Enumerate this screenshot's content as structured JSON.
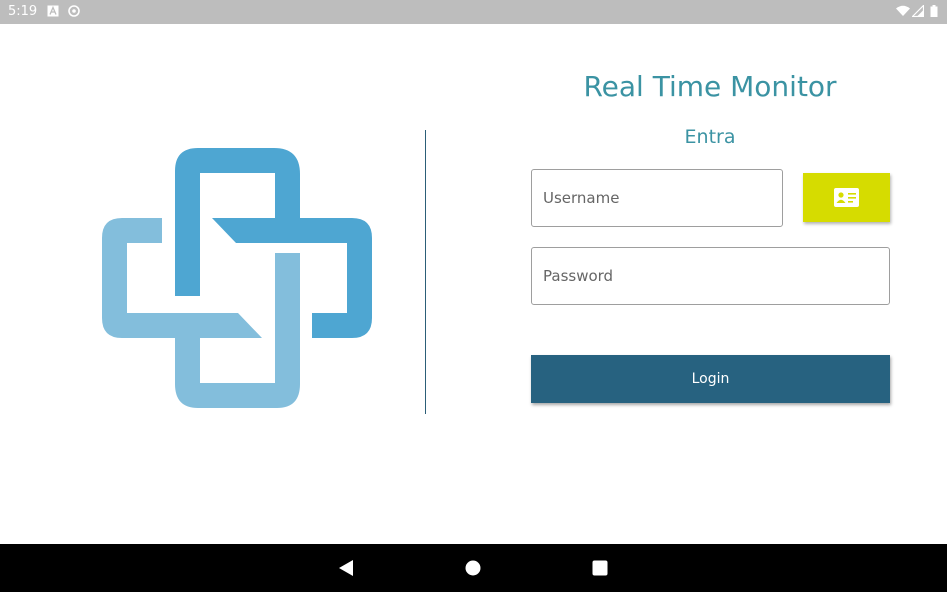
{
  "status_bar": {
    "time": "5:19",
    "left_icons": [
      "a-icon",
      "sync-icon"
    ],
    "right_icons": [
      "wifi-icon",
      "signal-icon",
      "battery-icon"
    ]
  },
  "login": {
    "title": "Real Time Monitor",
    "subtitle": "Entra",
    "username_placeholder": "Username",
    "password_placeholder": "Password",
    "card_button_icon": "id-card-icon",
    "login_label": "Login"
  },
  "nav_bar": {
    "icons": [
      "back-icon",
      "home-icon",
      "recents-icon"
    ]
  },
  "colors": {
    "accent": "#3b93a3",
    "logo_dark": "#4ea6d2",
    "logo_light": "#83bedc",
    "card_button": "#d6dc00",
    "login_button": "#276280"
  }
}
